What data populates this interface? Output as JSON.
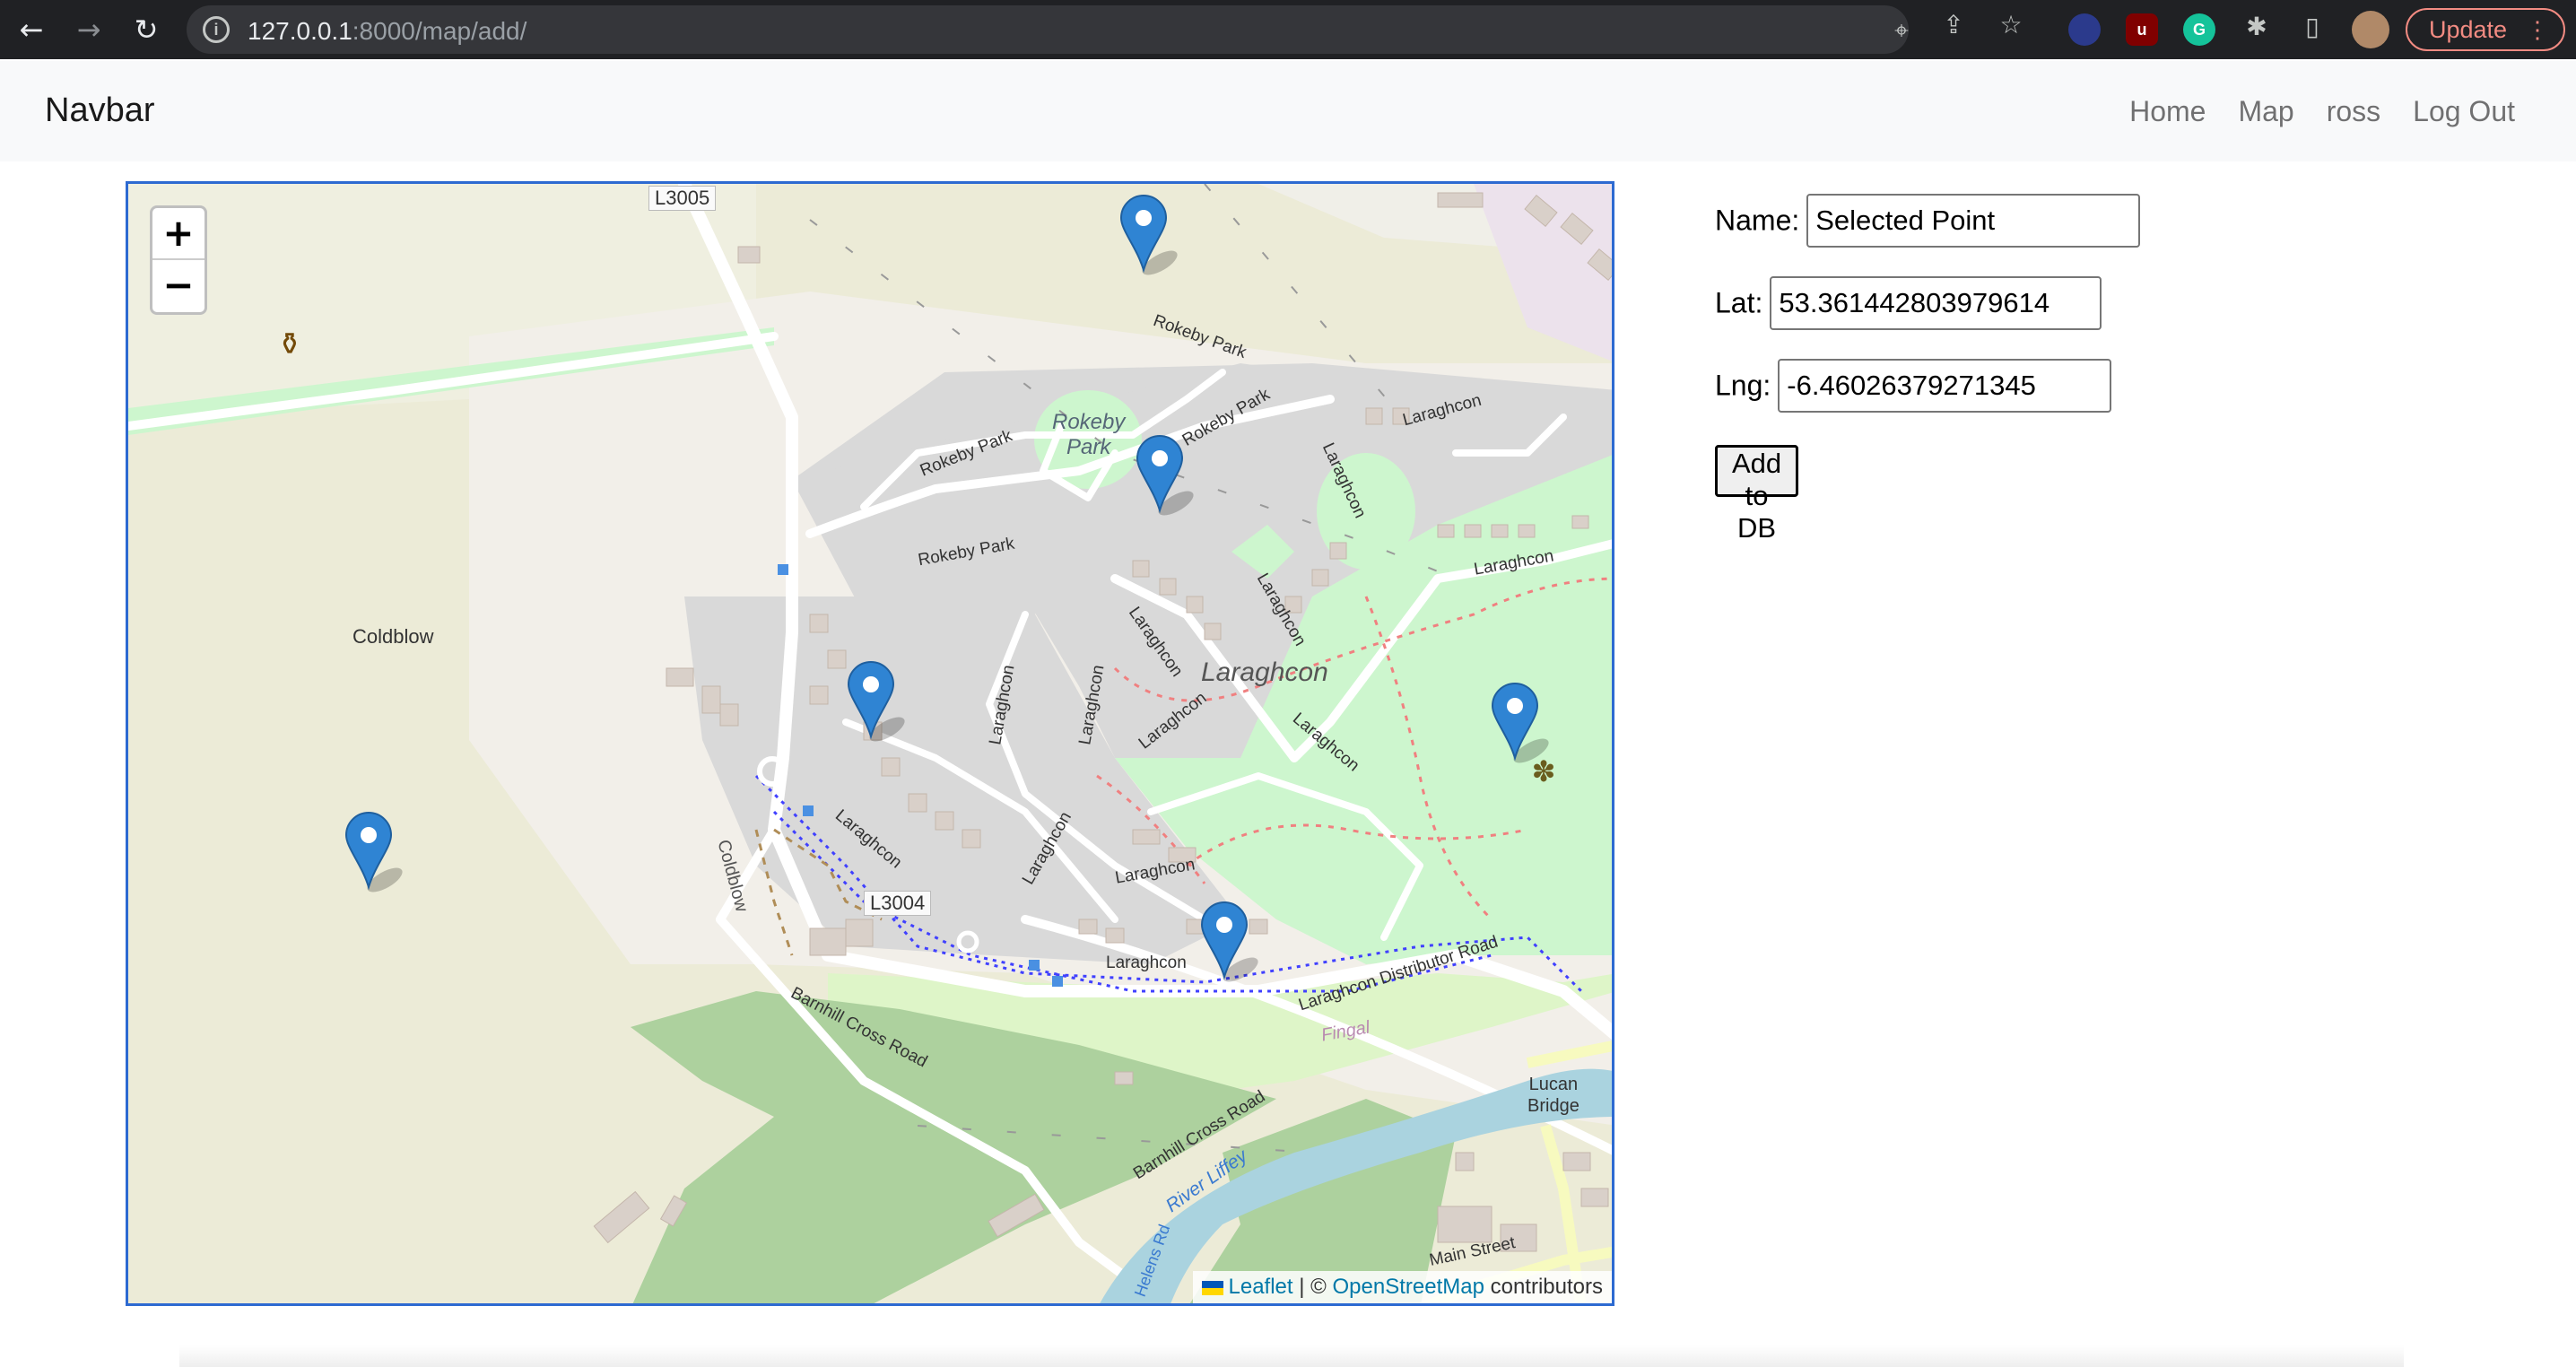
{
  "browser": {
    "url_host": "127.0.0.1",
    "url_rest": ":8000/map/add/",
    "update_label": "Update"
  },
  "navbar": {
    "brand": "Navbar",
    "links": [
      "Home",
      "Map",
      "ross",
      "Log Out"
    ]
  },
  "map": {
    "zoom_in": "+",
    "zoom_out": "−",
    "attribution": {
      "leaflet": "Leaflet",
      "separator": " | © ",
      "osm": "OpenStreetMap",
      "suffix": " contributors"
    },
    "labels": {
      "l3005": "L3005",
      "l3004": "L3004",
      "coldblow": "Coldblow",
      "coldblow_road": "Coldblow",
      "rokeby_park_area": "Rokeby\nPark",
      "rokeby_park_1": "Rokeby Park",
      "rokeby_park_2": "Rokeby Park",
      "rokeby_park_3": "Rokeby Park",
      "rokeby_park_4": "Rokeby Park",
      "laraghcon_area": "Laraghcon",
      "laraghcon_1": "Laraghcon",
      "laraghcon_2": "Laraghcon",
      "laraghcon_3": "Laraghcon",
      "laraghcon_4": "Laraghcon",
      "laraghcon_5": "Laraghcon",
      "laraghcon_6": "Laraghcon",
      "laraghcon_7": "Laraghcon",
      "laraghcon_8": "Laraghcon",
      "laraghcon_9": "Laraghcon",
      "laraghcon_10": "Laraghcon",
      "laraghcon_11": "Laraghcon",
      "laraghcon_12": "Laraghcon",
      "laraghcon_13": "Laraghcon",
      "distributor_road": "Laraghcon Distributor Road",
      "barnhill_1": "Barnhill Cross Road",
      "barnhill_2": "Barnhill Cross Road",
      "fingal": "Fingal",
      "river_liffey": "River Liffey",
      "lucan_bridge": "Lucan\nBridge",
      "main_street": "Main Street",
      "helens_rd": "Helens Rd"
    },
    "marker_count": 6
  },
  "form": {
    "name_label": "Name:",
    "name_value": "Selected Point",
    "lat_label": "Lat:",
    "lat_value": "53.361442803979614",
    "lng_label": "Lng:",
    "lng_value": "-6.46026379271345",
    "submit_label": "Add to DB"
  }
}
